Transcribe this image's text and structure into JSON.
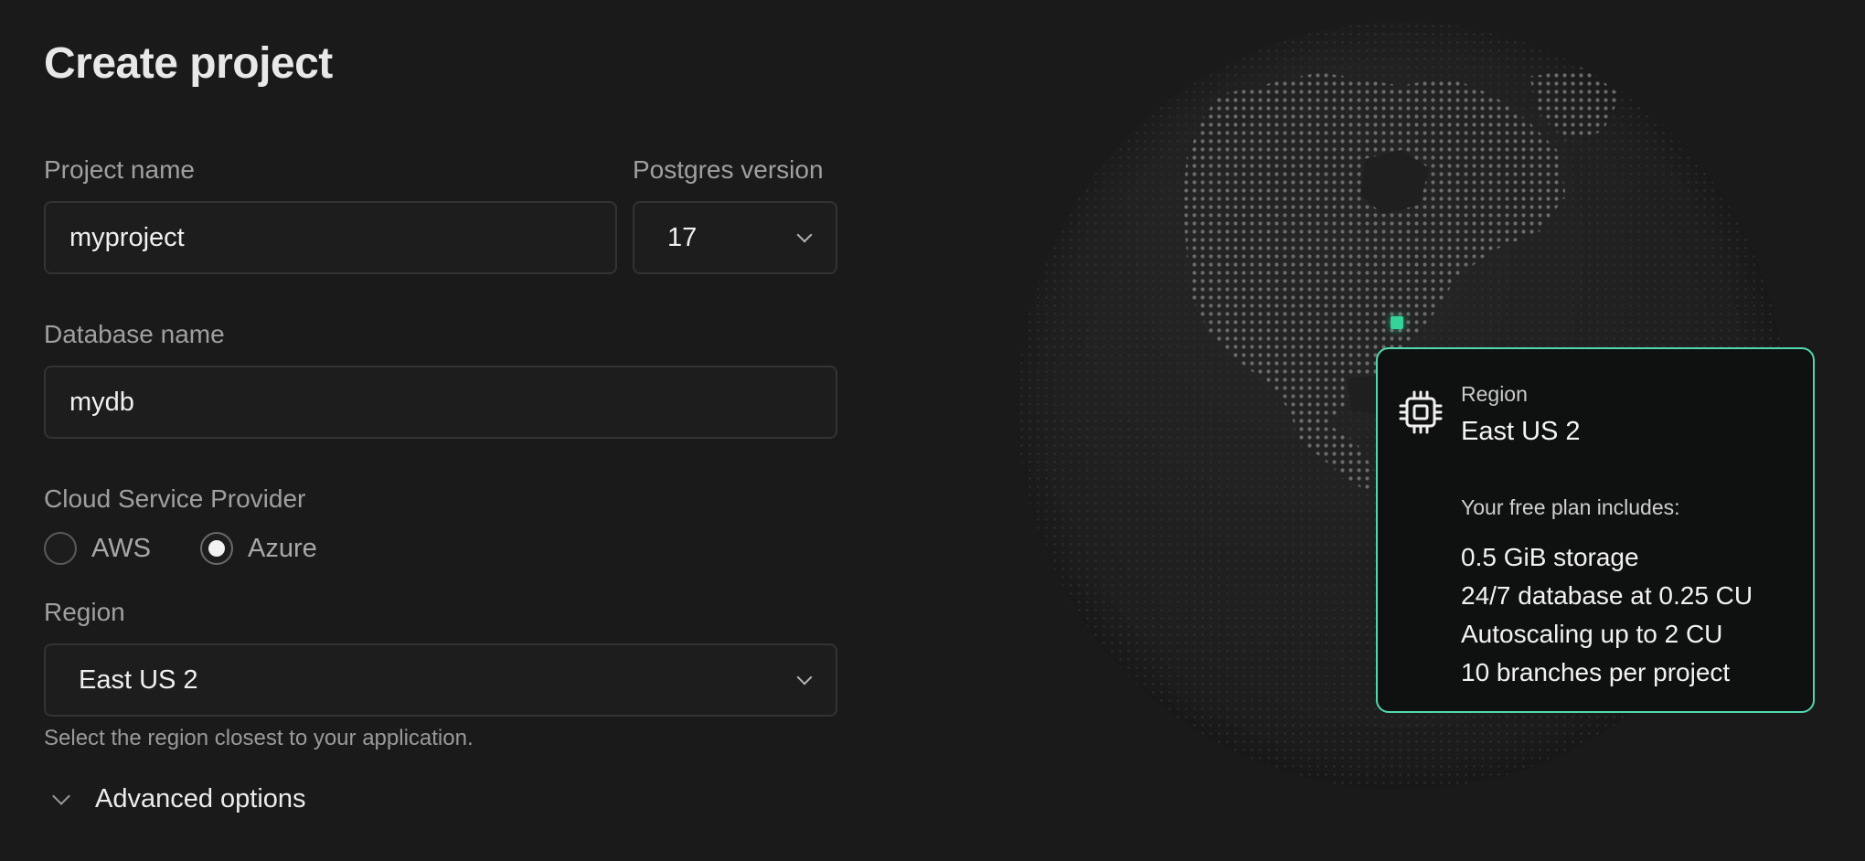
{
  "page": {
    "title": "Create project"
  },
  "form": {
    "project_name": {
      "label": "Project name",
      "value": "myproject"
    },
    "postgres_version": {
      "label": "Postgres version",
      "value": "17"
    },
    "database_name": {
      "label": "Database name",
      "value": "mydb"
    },
    "cloud_provider": {
      "label": "Cloud Service Provider",
      "options": [
        {
          "label": "AWS",
          "checked": false
        },
        {
          "label": "Azure",
          "checked": true
        }
      ]
    },
    "region": {
      "label": "Region",
      "value": "East US 2",
      "hint": "Select the region closest to your application."
    },
    "advanced": {
      "label": "Advanced options"
    }
  },
  "region_card": {
    "label": "Region",
    "region": "East US 2",
    "plan_heading": "Your free plan includes:",
    "features": [
      "0.5 GiB storage",
      "24/7 database at 0.25 CU",
      "Autoscaling up to 2 CU",
      "10 branches per project"
    ],
    "accent_color": "#4fd8b0",
    "marker_color": "#34d399",
    "icon": "chip-icon"
  }
}
